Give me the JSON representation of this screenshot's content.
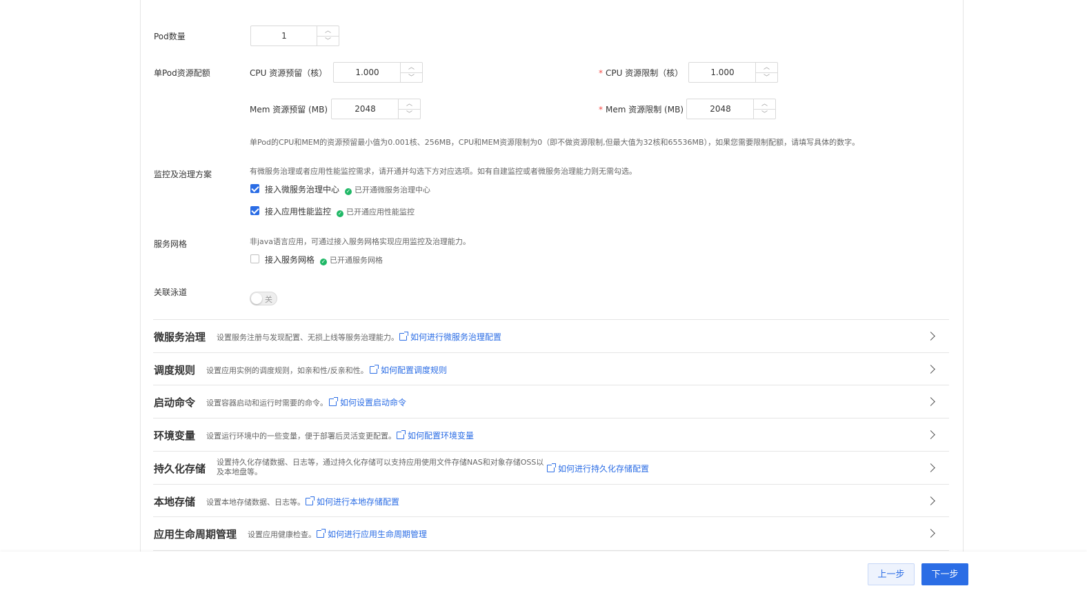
{
  "pod_count": {
    "label": "Pod数量",
    "value": "1"
  },
  "resources": {
    "label": "单Pod资源配额",
    "cpu_request": {
      "label": "CPU 资源预留（核）",
      "value": "1.000"
    },
    "cpu_limit": {
      "required": "*",
      "label": "CPU 资源限制（核）",
      "value": "1.000"
    },
    "mem_request": {
      "label": "Mem 资源预留 (MB)",
      "value": "2048"
    },
    "mem_limit": {
      "required": "*",
      "label": "Mem 资源限制 (MB)",
      "value": "2048"
    },
    "hint": "单Pod的CPU和MEM的资源预留最小值为0.001核、256MB，CPU和MEM资源限制为0（即不做资源限制,但最大值为32核和65536MB），如果您需要限制配额，请填写具体的数字。"
  },
  "monitoring": {
    "label": "监控及治理方案",
    "hint": "有微服务治理或者应用性能监控需求，请开通并勾选下方对应选项。如有自建监控或者微服务治理能力则无需勾选。",
    "options": [
      {
        "label": "接入微服务治理中心",
        "checked": true,
        "status": "已开通微服务治理中心"
      },
      {
        "label": "接入应用性能监控",
        "checked": true,
        "status": "已开通应用性能监控"
      }
    ]
  },
  "mesh": {
    "label": "服务网格",
    "hint": "非java语言应用，可通过接入服务网格实现应用监控及治理能力。",
    "option": {
      "label": "接入服务网格",
      "checked": false,
      "status": "已开通服务网格"
    }
  },
  "lane": {
    "label": "关联泳道",
    "switch_text": "关",
    "on": false
  },
  "sections": [
    {
      "title": "微服务治理",
      "desc": "设置服务注册与发现配置、无损上线等服务治理能力。",
      "link": "如何进行微服务治理配置"
    },
    {
      "title": "调度规则",
      "desc": "设置应用实例的调度规则，如亲和性/反亲和性。",
      "link": "如何配置调度规则"
    },
    {
      "title": "启动命令",
      "desc": "设置容器启动和运行时需要的命令。",
      "link": "如何设置启动命令"
    },
    {
      "title": "环境变量",
      "desc": "设置运行环境中的一些变量，便于部署后灵活变更配置。",
      "link": "如何配置环境变量"
    },
    {
      "title": "持久化存储",
      "desc": "设置持久化存储数据、日志等，通过持久化存储可以支持应用使用文件存储NAS和对象存储OSS以及本地盘等。",
      "link": "如何进行持久化存储配置"
    },
    {
      "title": "本地存储",
      "desc": "设置本地存储数据、日志等。",
      "link": "如何进行本地存储配置"
    },
    {
      "title": "应用生命周期管理",
      "desc": "设置应用健康检查。",
      "link": "如何进行应用生命周期管理"
    }
  ],
  "footer": {
    "prev": "上一步",
    "next": "下一步"
  },
  "colors": {
    "accent": "#2b6de5",
    "success": "#1fb866",
    "required": "#f54a45"
  }
}
